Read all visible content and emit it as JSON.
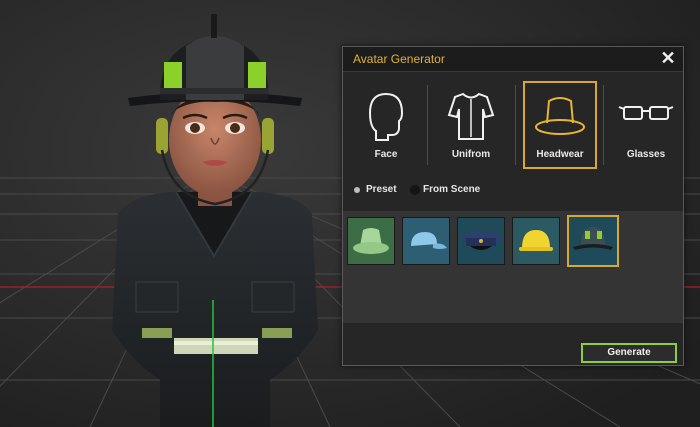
{
  "panel": {
    "title": "Avatar Generator",
    "close_symbol": "✕",
    "categories": [
      {
        "label": "Face",
        "icon": "head-silhouette-icon",
        "selected": false
      },
      {
        "label": "Unifrom",
        "icon": "shirt-icon",
        "selected": false
      },
      {
        "label": "Headwear",
        "icon": "hat-icon",
        "selected": true
      },
      {
        "label": "Glasses",
        "icon": "glasses-icon",
        "selected": false
      }
    ],
    "source": {
      "preset_label": "Preset",
      "scene_label": "From Scene",
      "selected": "Preset"
    },
    "thumbnails": [
      {
        "item": "bucket-hat",
        "color": "#a6d69a",
        "bg": "#3d6d46",
        "selected": false
      },
      {
        "item": "baseball-cap",
        "color": "#8fc9ea",
        "bg": "#2d5e73",
        "selected": false
      },
      {
        "item": "police-cap",
        "color": "#2d3f6b",
        "bg": "#1f4a5a",
        "selected": false
      },
      {
        "item": "hard-hat",
        "color": "#f2d431",
        "bg": "#2c5a63",
        "selected": false
      },
      {
        "item": "firefighter-helmet",
        "color": "#3b4d55",
        "bg": "#1f4a5a",
        "selected": true
      }
    ],
    "generate_label": "Generate"
  },
  "colors": {
    "accent": "#d9a92e",
    "generate_border": "#8bcf3c",
    "title": "#e0b23a"
  }
}
